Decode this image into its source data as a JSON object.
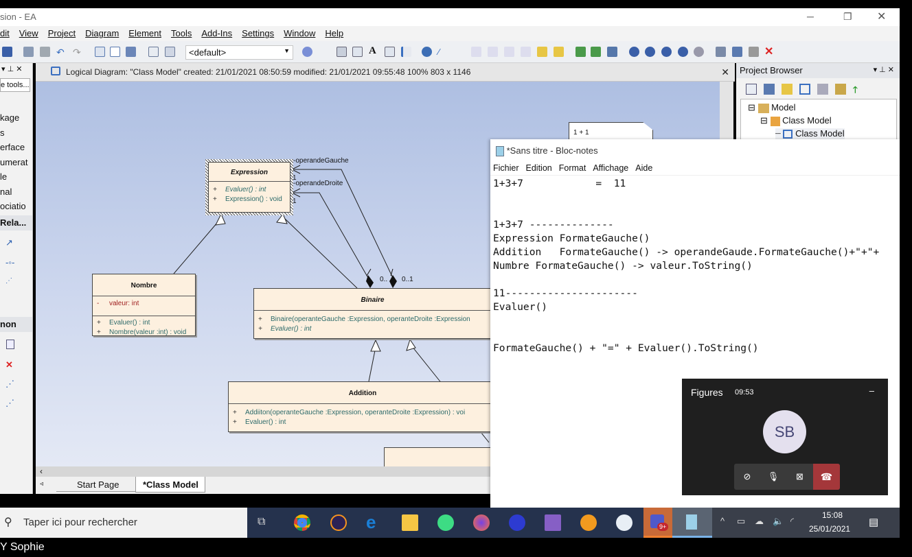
{
  "app": {
    "title": "sion - EA"
  },
  "menu": [
    "dit",
    "View",
    "Project",
    "Diagram",
    "Element",
    "Tools",
    "Add-Ins",
    "Settings",
    "Window",
    "Help"
  ],
  "toolbar": {
    "combo_value": "<default>"
  },
  "left_panel": {
    "tools_button": "e tools...",
    "items": [
      "kage",
      "s",
      "erface",
      "umerat",
      "le",
      "nal",
      "ociatio"
    ],
    "section_relations": "Rela...",
    "section_common": "non"
  },
  "diagram": {
    "header": "Logical Diagram: \"Class Model\"   created: 21/01/2021 08:50:59  modified: 21/01/2021 09:55:48   100%   803 x 1146",
    "note": "1 + 1",
    "classes": {
      "expression": {
        "name": "Expression",
        "ops": [
          {
            "vis": "+",
            "sig": "Evaluer() : int"
          },
          {
            "vis": "+",
            "sig": "Expression() : void"
          }
        ]
      },
      "nombre": {
        "name": "Nombre",
        "attrs": [
          {
            "vis": "-",
            "sig": "valeur:  int"
          }
        ],
        "ops": [
          {
            "vis": "+",
            "sig": "Evaluer() : int"
          },
          {
            "vis": "+",
            "sig": "Nombre(valeur :int) : void"
          }
        ]
      },
      "binaire": {
        "name": "Binaire",
        "ops": [
          {
            "vis": "+",
            "sig": "Binaire(operanteGauche :Expression, operanteDroite :Expression"
          },
          {
            "vis": "+",
            "sig": "Evaluer() : int"
          }
        ]
      },
      "addition": {
        "name": "Addition",
        "ops": [
          {
            "vis": "+",
            "sig": "Addiiton(operanteGauche :Expression, operanteDroite :Expression) : voi"
          },
          {
            "vis": "+",
            "sig": "Evaluer() : int"
          }
        ]
      }
    },
    "labels": {
      "role_left": "-operandeGauche",
      "role_right": "-operandeDroite",
      "mult1": "1",
      "mult2": "1",
      "mult3": "0..",
      "mult4": "0..1"
    },
    "tabs": [
      "Start Page",
      "*Class Model"
    ]
  },
  "project_browser": {
    "title": "Project Browser",
    "tree": [
      "Model",
      "Class Model",
      "Class Model"
    ]
  },
  "notepad": {
    "title": "*Sans titre - Bloc-notes",
    "menu": [
      "Fichier",
      "Edition",
      "Format",
      "Affichage",
      "Aide"
    ],
    "text": "1+3+7            =  11\n\n\n1+3+7 --------------\nExpression FormateGauche()\nAddition   FormateGauche() -> operandeGaude.FormateGauche()+\"+\"+\nNumbre FormateGauche() -> valeur.ToString()\n\n11----------------------\nEvaluer()\n\n\nFormateGauche() + \"=\" + Evaluer().ToString()"
  },
  "teams": {
    "title": "Figures",
    "time": "09:53",
    "initials": "SB",
    "minimize": "–"
  },
  "taskbar": {
    "search_placeholder": "Taper ici pour rechercher",
    "time": "15:08",
    "date": "25/01/2021",
    "teams_badge": "9+"
  },
  "footer": {
    "name": "Y Sophie"
  }
}
